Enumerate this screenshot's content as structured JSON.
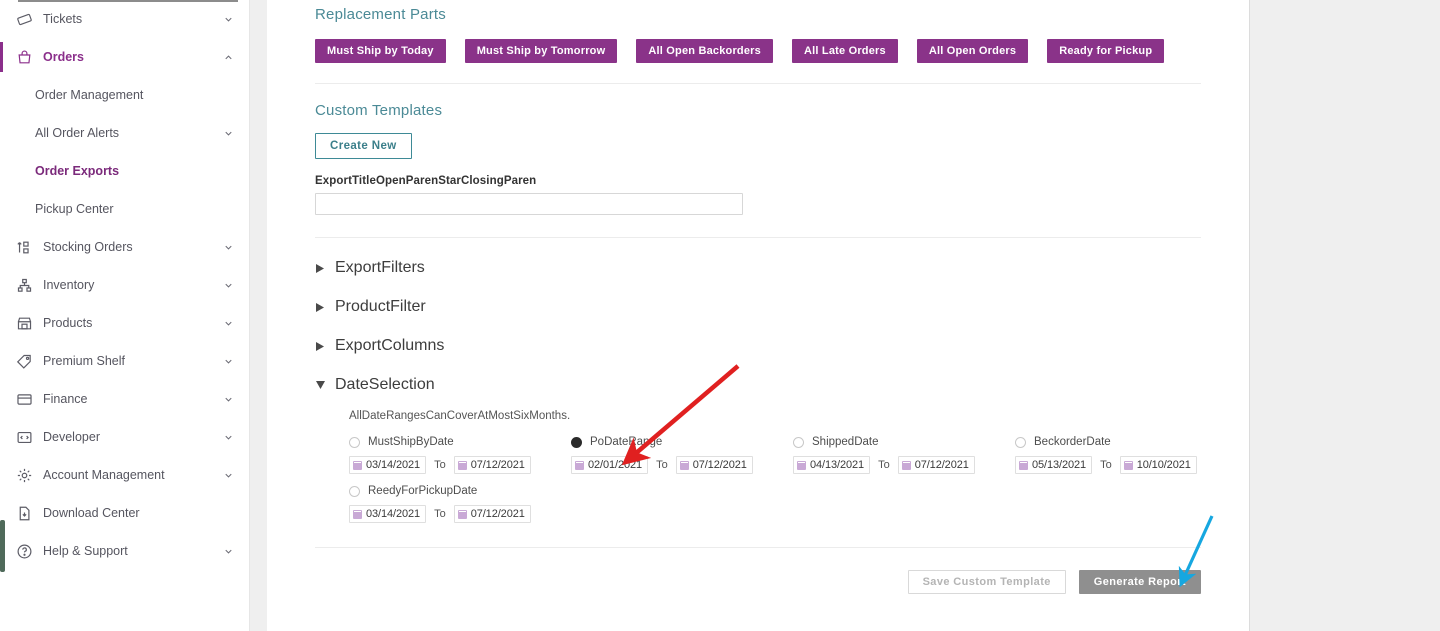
{
  "sidebar": {
    "scroll_indicator": "scroll-thumb",
    "items": [
      {
        "label": "Tickets",
        "icon": "ticket-icon",
        "chevron": "chevron-down-icon",
        "state": "collapsed"
      },
      {
        "label": "Orders",
        "icon": "bag-icon",
        "chevron": "chevron-up-icon",
        "state": "expanded"
      },
      {
        "label": "Stocking Orders",
        "icon": "transfer-icon",
        "chevron": "chevron-down-icon",
        "state": "collapsed"
      },
      {
        "label": "Inventory",
        "icon": "sitemap-icon",
        "chevron": "chevron-down-icon",
        "state": "collapsed"
      },
      {
        "label": "Products",
        "icon": "store-icon",
        "chevron": "chevron-down-icon",
        "state": "collapsed"
      },
      {
        "label": "Premium Shelf",
        "icon": "tag-icon",
        "chevron": "chevron-down-icon",
        "state": "collapsed"
      },
      {
        "label": "Finance",
        "icon": "card-icon",
        "chevron": "chevron-down-icon",
        "state": "collapsed"
      },
      {
        "label": "Developer",
        "icon": "code-icon",
        "chevron": "chevron-down-icon",
        "state": "collapsed"
      },
      {
        "label": "Account Management",
        "icon": "gear-icon",
        "chevron": "chevron-down-icon",
        "state": "collapsed"
      },
      {
        "label": "Download Center",
        "icon": "file-download-icon",
        "chevron": "",
        "state": "none"
      },
      {
        "label": "Help & Support",
        "icon": "question-circle-icon",
        "chevron": "chevron-down-icon",
        "state": "collapsed"
      }
    ],
    "orders_children": [
      {
        "label": "Order Management",
        "chevron": "",
        "selected": false
      },
      {
        "label": "All Order Alerts",
        "chevron": "chevron-down-icon",
        "selected": false
      },
      {
        "label": "Order Exports",
        "chevron": "",
        "selected": true
      },
      {
        "label": "Pickup Center",
        "chevron": "",
        "selected": false
      }
    ]
  },
  "main": {
    "replacement_parts": {
      "title": "Replacement Parts",
      "buttons": [
        "Must Ship by Today",
        "Must Ship by Tomorrow",
        "All Open Backorders",
        "All Late Orders",
        "All Open Orders",
        "Ready for Pickup"
      ]
    },
    "custom_templates": {
      "title": "Custom Templates",
      "create_new_label": "Create New",
      "export_title_label": "ExportTitleOpenParenStarClosingParen",
      "export_title_value": "",
      "export_title_placeholder": ""
    },
    "accordions": [
      {
        "label": "ExportFilters",
        "expanded": false,
        "marker": "triangle-right-icon"
      },
      {
        "label": "ProductFilter",
        "expanded": false,
        "marker": "triangle-right-icon"
      },
      {
        "label": "ExportColumns",
        "expanded": false,
        "marker": "triangle-right-icon"
      },
      {
        "label": "DateSelection",
        "expanded": true,
        "marker": "triangle-down-icon"
      }
    ],
    "date_selection": {
      "note": "AllDateRangesCanCoverAtMostSixMonths.",
      "to_label": "To",
      "options": [
        {
          "label": "MustShipByDate",
          "selected": false,
          "from": "03/14/2021",
          "to": "07/12/2021"
        },
        {
          "label": "PoDateRange",
          "selected": true,
          "from": "02/01/2021",
          "to": "07/12/2021"
        },
        {
          "label": "ShippedDate",
          "selected": false,
          "from": "04/13/2021",
          "to": "07/12/2021"
        },
        {
          "label": "BeckorderDate",
          "selected": false,
          "from": "05/13/2021",
          "to": "10/10/2021"
        },
        {
          "label": "ReedyForPickupDate",
          "selected": false,
          "from": "03/14/2021",
          "to": "07/12/2021"
        }
      ]
    },
    "footer": {
      "save_label": "Save Custom Template",
      "generate_label": "Generate Report"
    }
  },
  "annotations": [
    {
      "name": "red-arrow",
      "color": "#e02020",
      "points_to": "PoDateRange radio"
    },
    {
      "name": "blue-arrow",
      "color": "#16a7e0",
      "points_to": "Generate Report button"
    }
  ],
  "colors": {
    "accent_purple": "#8A3389",
    "heading_teal": "#4b8a96",
    "panel_bg": "#ffffff",
    "page_bg": "#efefef",
    "generate_gray": "#8f8f8f"
  }
}
